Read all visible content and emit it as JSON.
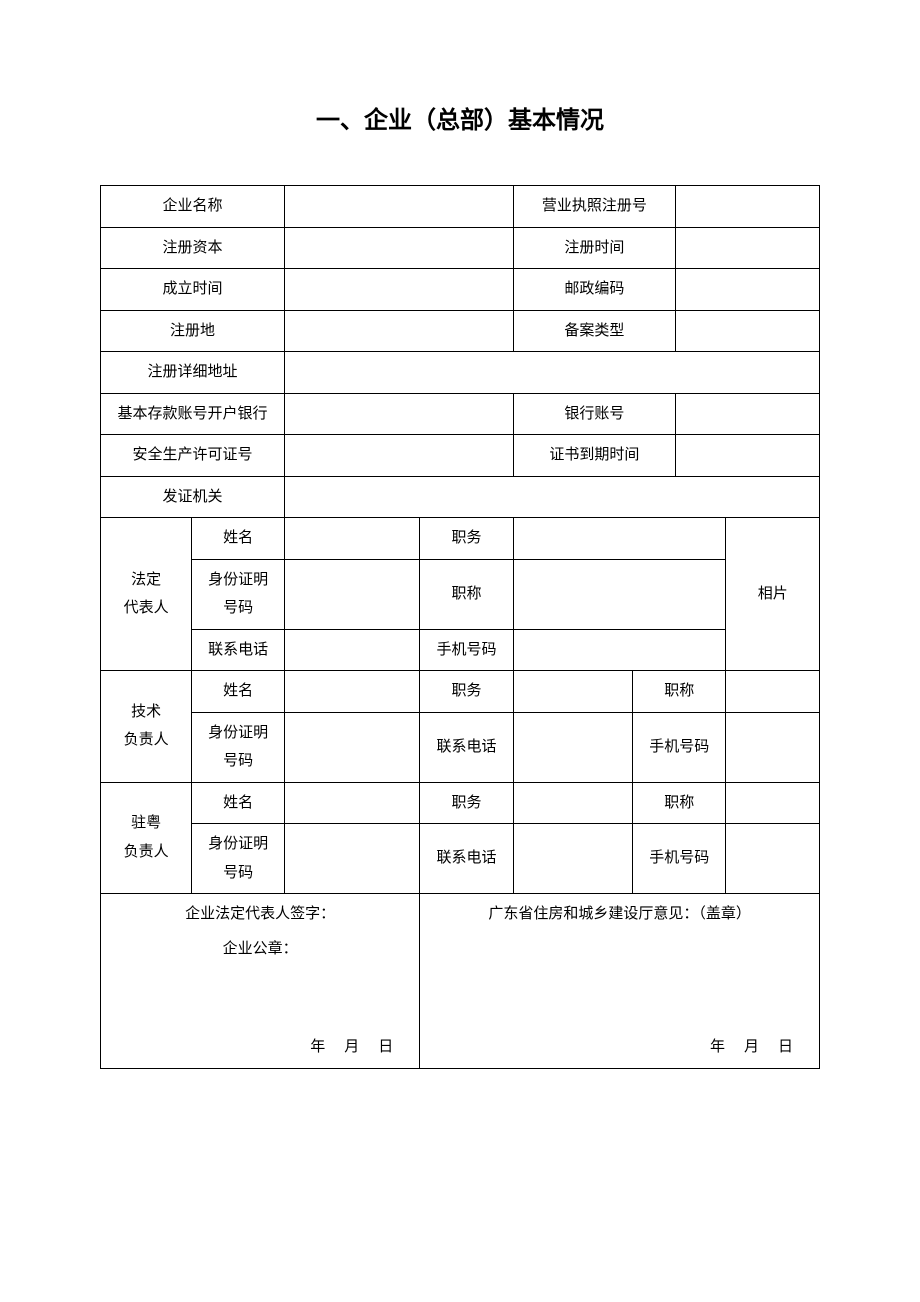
{
  "title": "一、企业（总部）基本情况",
  "rows": {
    "r1a": "企业名称",
    "r1b": "营业执照注册号",
    "r2a": "注册资本",
    "r2b": "注册时间",
    "r3a": "成立时间",
    "r3b": "邮政编码",
    "r4a": "注册地",
    "r4b": "备案类型",
    "r5a": "注册详细地址",
    "r6a": "基本存款账号开户银行",
    "r6b": "银行账号",
    "r7a": "安全生产许可证号",
    "r7b": "证书到期时间",
    "r8a": "发证机关"
  },
  "legal": {
    "group": "法定代表人",
    "name": "姓名",
    "duty": "职务",
    "id": "身份证明号码",
    "title": "职称",
    "tel": "联系电话",
    "mobile": "手机号码",
    "photo": "相片"
  },
  "tech": {
    "group": "技术负责人",
    "name": "姓名",
    "duty": "职务",
    "title": "职称",
    "id": "身份证明号码",
    "tel": "联系电话",
    "mobile": "手机号码"
  },
  "yue": {
    "group": "驻粤负责人",
    "name": "姓名",
    "duty": "职务",
    "title": "职称",
    "id": "身份证明号码",
    "tel": "联系电话",
    "mobile": "手机号码"
  },
  "sign": {
    "left1": "企业法定代表人签字：",
    "left2": "企业公章：",
    "right1": "广东省住房和城乡建设厅意见：（盖章）",
    "date": "年　月　日"
  }
}
